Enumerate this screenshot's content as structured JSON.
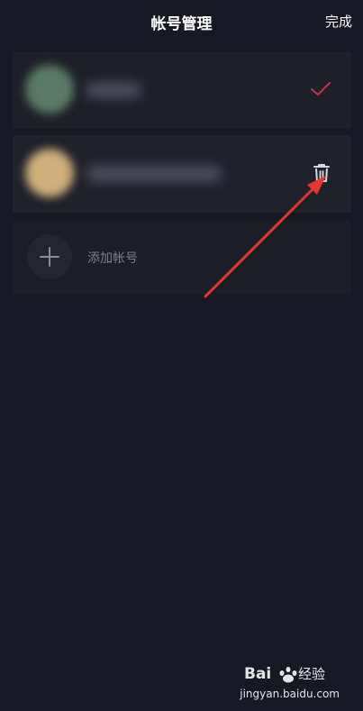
{
  "header": {
    "title": "帐号管理",
    "done_label": "完成"
  },
  "accounts": [
    {
      "status": "current",
      "action_icon": "check-icon"
    },
    {
      "status": "other",
      "action_icon": "trash-icon"
    }
  ],
  "add_account": {
    "label": "添加帐号",
    "icon": "plus-icon"
  },
  "annotation": {
    "color": "#e8352b"
  },
  "watermark": {
    "logo_text": "Bai 经验",
    "url": "jingyan.baidu.com"
  },
  "colors": {
    "background": "#161823",
    "card": "#1e2029",
    "check": "#c8324a"
  }
}
